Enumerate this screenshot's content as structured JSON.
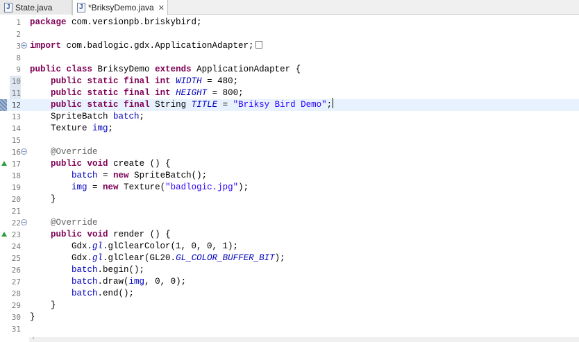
{
  "tabs": [
    {
      "label": "State.java",
      "active": false
    },
    {
      "label": "*BriksyDemo.java",
      "active": true,
      "close_glyph": "✕"
    }
  ],
  "editor": {
    "current_line": 12,
    "lines": [
      {
        "n": "1",
        "parts": [
          [
            "kw",
            "package"
          ],
          [
            "t",
            " com.versionpb.briskybird;"
          ]
        ]
      },
      {
        "n": "2",
        "parts": []
      },
      {
        "n": "3",
        "parts": [
          [
            "kw",
            "import"
          ],
          [
            "t",
            " com.badlogic.gdx.ApplicationAdapter;"
          ]
        ],
        "fold": "plus",
        "collapsed": true
      },
      {
        "n": "8",
        "parts": []
      },
      {
        "n": "9",
        "parts": [
          [
            "kw",
            "public"
          ],
          [
            "t",
            " "
          ],
          [
            "kw",
            "class"
          ],
          [
            "t",
            " BriksyDemo "
          ],
          [
            "kw",
            "extends"
          ],
          [
            "t",
            " ApplicationAdapter {"
          ]
        ]
      },
      {
        "n": "10",
        "parts": [
          [
            "t",
            "    "
          ],
          [
            "kw",
            "public"
          ],
          [
            "t",
            " "
          ],
          [
            "kw",
            "static"
          ],
          [
            "t",
            " "
          ],
          [
            "kw",
            "final"
          ],
          [
            "t",
            " "
          ],
          [
            "kw",
            "int"
          ],
          [
            "t",
            " "
          ],
          [
            "sfield",
            "WIDTH"
          ],
          [
            "t",
            " = 480;"
          ]
        ],
        "lnbar": true
      },
      {
        "n": "11",
        "parts": [
          [
            "t",
            "    "
          ],
          [
            "kw",
            "public"
          ],
          [
            "t",
            " "
          ],
          [
            "kw",
            "static"
          ],
          [
            "t",
            " "
          ],
          [
            "kw",
            "final"
          ],
          [
            "t",
            " "
          ],
          [
            "kw",
            "int"
          ],
          [
            "t",
            " "
          ],
          [
            "sfield",
            "HEIGHT"
          ],
          [
            "t",
            " = 800;"
          ]
        ],
        "lnbar": true
      },
      {
        "n": "12",
        "parts": [
          [
            "t",
            "    "
          ],
          [
            "kw",
            "public"
          ],
          [
            "t",
            " "
          ],
          [
            "kw",
            "static"
          ],
          [
            "t",
            " "
          ],
          [
            "kw",
            "final"
          ],
          [
            "t",
            " String "
          ],
          [
            "sfield",
            "TITLE"
          ],
          [
            "t",
            " = "
          ],
          [
            "str",
            "\"Briksy Bird Demo\""
          ],
          [
            "t",
            ";"
          ]
        ],
        "mark": true,
        "caret": true
      },
      {
        "n": "13",
        "parts": [
          [
            "t",
            "    SpriteBatch "
          ],
          [
            "field",
            "batch"
          ],
          [
            "t",
            ";"
          ]
        ]
      },
      {
        "n": "14",
        "parts": [
          [
            "t",
            "    Texture "
          ],
          [
            "field",
            "img"
          ],
          [
            "t",
            ";"
          ]
        ]
      },
      {
        "n": "15",
        "parts": []
      },
      {
        "n": "16",
        "parts": [
          [
            "t",
            "    "
          ],
          [
            "ann",
            "@Override"
          ]
        ],
        "fold": "minus"
      },
      {
        "n": "17",
        "parts": [
          [
            "t",
            "    "
          ],
          [
            "kw",
            "public"
          ],
          [
            "t",
            " "
          ],
          [
            "kw",
            "void"
          ],
          [
            "t",
            " create () {"
          ]
        ],
        "override": true
      },
      {
        "n": "18",
        "parts": [
          [
            "t",
            "        "
          ],
          [
            "field",
            "batch"
          ],
          [
            "t",
            " = "
          ],
          [
            "kw",
            "new"
          ],
          [
            "t",
            " SpriteBatch();"
          ]
        ]
      },
      {
        "n": "19",
        "parts": [
          [
            "t",
            "        "
          ],
          [
            "field",
            "img"
          ],
          [
            "t",
            " = "
          ],
          [
            "kw",
            "new"
          ],
          [
            "t",
            " Texture("
          ],
          [
            "str",
            "\"badlogic.jpg\""
          ],
          [
            "t",
            ");"
          ]
        ]
      },
      {
        "n": "20",
        "parts": [
          [
            "t",
            "    }"
          ]
        ]
      },
      {
        "n": "21",
        "parts": []
      },
      {
        "n": "22",
        "parts": [
          [
            "t",
            "    "
          ],
          [
            "ann",
            "@Override"
          ]
        ],
        "fold": "minus"
      },
      {
        "n": "23",
        "parts": [
          [
            "t",
            "    "
          ],
          [
            "kw",
            "public"
          ],
          [
            "t",
            " "
          ],
          [
            "kw",
            "void"
          ],
          [
            "t",
            " render () {"
          ]
        ],
        "override": true
      },
      {
        "n": "24",
        "parts": [
          [
            "t",
            "        Gdx."
          ],
          [
            "sfield",
            "gl"
          ],
          [
            "t",
            ".glClearColor(1, 0, 0, 1);"
          ]
        ]
      },
      {
        "n": "25",
        "parts": [
          [
            "t",
            "        Gdx."
          ],
          [
            "sfield",
            "gl"
          ],
          [
            "t",
            ".glClear(GL20."
          ],
          [
            "sfield",
            "GL_COLOR_BUFFER_BIT"
          ],
          [
            "t",
            ");"
          ]
        ]
      },
      {
        "n": "26",
        "parts": [
          [
            "t",
            "        "
          ],
          [
            "field",
            "batch"
          ],
          [
            "t",
            ".begin();"
          ]
        ]
      },
      {
        "n": "27",
        "parts": [
          [
            "t",
            "        "
          ],
          [
            "field",
            "batch"
          ],
          [
            "t",
            ".draw("
          ],
          [
            "field",
            "img"
          ],
          [
            "t",
            ", 0, 0);"
          ]
        ]
      },
      {
        "n": "28",
        "parts": [
          [
            "t",
            "        "
          ],
          [
            "field",
            "batch"
          ],
          [
            "t",
            ".end();"
          ]
        ]
      },
      {
        "n": "29",
        "parts": [
          [
            "t",
            "    }"
          ]
        ]
      },
      {
        "n": "30",
        "parts": [
          [
            "t",
            "}"
          ]
        ]
      },
      {
        "n": "31",
        "parts": []
      }
    ]
  },
  "colors": {
    "keyword": "#7f0055",
    "field": "#0000c0",
    "string": "#2a00ff",
    "annotation": "#646464",
    "current_line_bg": "#e8f2fe"
  },
  "icons": {
    "java_file_icon": "J",
    "fold_expand": "+",
    "fold_collapse": "−"
  }
}
